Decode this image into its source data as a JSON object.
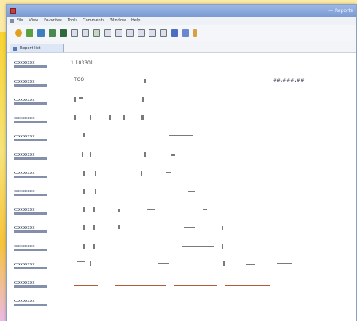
{
  "window": {
    "title": "— Reports",
    "tab_label": "Report list"
  },
  "menu": [
    "File",
    "View",
    "Favorites",
    "Tools",
    "Comments",
    "Window",
    "Help"
  ],
  "toolbar_icons": [
    "back-icon",
    "forward-icon",
    "home-icon",
    "save-icon",
    "print-icon",
    "document-icon",
    "document-icon",
    "document-icon",
    "document-icon",
    "document-icon",
    "document-icon",
    "document-icon",
    "document-icon",
    "grid-icon",
    "list-icon",
    "chart-icon",
    "settings-icon"
  ],
  "content": {
    "top_code": "1.103301",
    "first_value": "TOO",
    "right_value": "##.###.##",
    "row_label": "xxxxxxxxx"
  }
}
